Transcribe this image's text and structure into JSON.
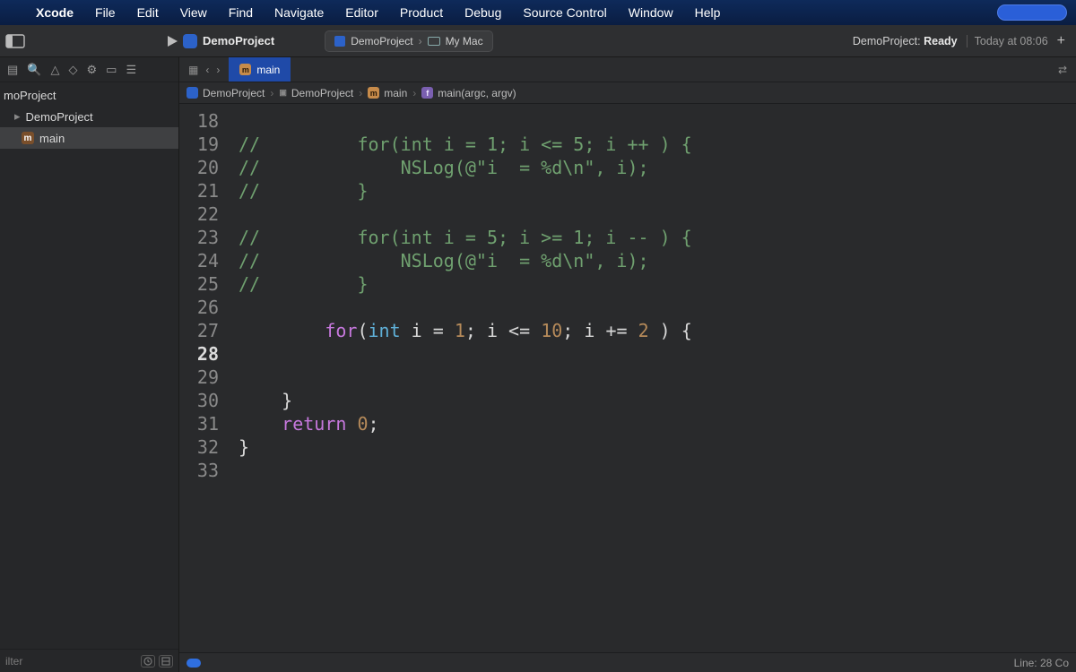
{
  "menu": {
    "items": [
      "Xcode",
      "File",
      "Edit",
      "View",
      "Find",
      "Navigate",
      "Editor",
      "Product",
      "Debug",
      "Source Control",
      "Window",
      "Help"
    ]
  },
  "toolbar": {
    "project_name": "DemoProject",
    "scheme": "DemoProject",
    "destination": "My Mac",
    "status_prefix": "DemoProject:",
    "status_state": "Ready",
    "status_time": "Today at 08:06"
  },
  "navigator": {
    "rows": [
      {
        "label": "moProject",
        "indent": 0,
        "selected": false,
        "icon": "none"
      },
      {
        "label": "DemoProject",
        "indent": 1,
        "selected": false,
        "icon": "folder"
      },
      {
        "label": "main",
        "indent": 2,
        "selected": true,
        "icon": "m"
      }
    ],
    "filter_placeholder": "ilter"
  },
  "tabbar": {
    "active_tab": "main"
  },
  "jumpbar": {
    "segments": [
      {
        "icon": "blue",
        "glyph": "",
        "label": "DemoProject"
      },
      {
        "icon": "folder",
        "glyph": "",
        "label": "DemoProject"
      },
      {
        "icon": "orange",
        "glyph": "m",
        "label": "main"
      },
      {
        "icon": "purple",
        "glyph": "f",
        "label": "main(argc, argv)"
      }
    ]
  },
  "code": {
    "first_line_number": 18,
    "current_line_number": 28,
    "lines": [
      "",
      "//         for(int i = 1; i <= 5; i ++ ) {",
      "//             NSLog(@\"i  = %d\\n\", i);",
      "//         }",
      "",
      "//         for(int i = 5; i >= 1; i -- ) {",
      "//             NSLog(@\"i  = %d\\n\", i);",
      "//         }",
      "",
      "        for(int i = 1; i <= 10; i += 2 ) {",
      "",
      "",
      "    }",
      "    return 0;",
      "}",
      ""
    ]
  },
  "editor_status": {
    "line_col": "Line: 28  Co"
  }
}
